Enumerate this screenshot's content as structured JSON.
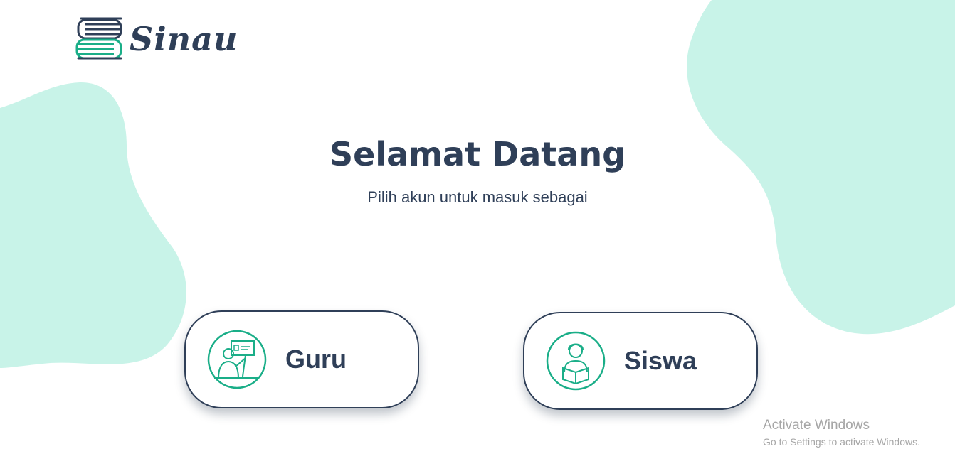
{
  "app": {
    "brand": "Sinau"
  },
  "hero": {
    "title": "Selamat Datang",
    "subtitle": "Pilih akun untuk masuk sebagai"
  },
  "roles": [
    {
      "label": "Guru",
      "icon": "teacher-icon"
    },
    {
      "label": "Siswa",
      "icon": "student-icon"
    }
  ],
  "watermark": {
    "title": "Activate Windows",
    "subtitle": "Go to Settings to activate Windows."
  },
  "colors": {
    "primary_text": "#2f3f58",
    "accent": "#1aae88",
    "blob": "#c8f3e8"
  }
}
